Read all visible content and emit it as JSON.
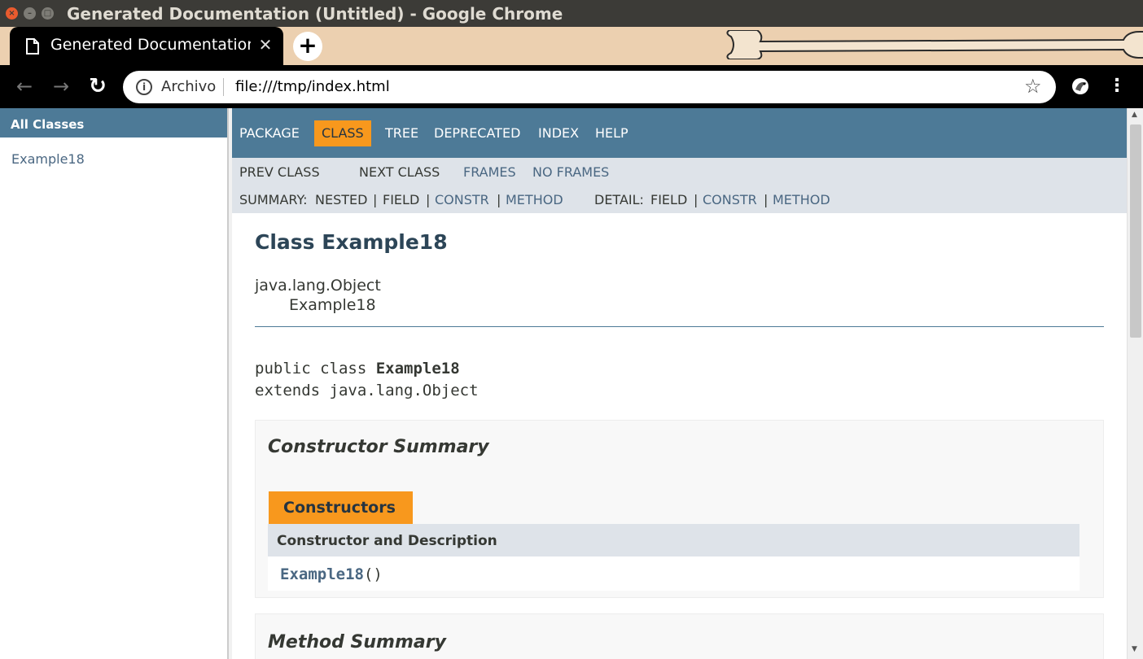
{
  "window": {
    "title": "Generated Documentation (Untitled) - Google Chrome"
  },
  "tab": {
    "title": "Generated Documentation (Untitled)",
    "close_glyph": "✕",
    "new_tab_glyph": "+"
  },
  "toolbar": {
    "back_glyph": "←",
    "forward_glyph": "→",
    "reload_glyph": "↻",
    "origin_chip": "Archivo",
    "url": "file:///tmp/index.html",
    "star_glyph": "☆",
    "menu_glyph": "⋮"
  },
  "left_frame": {
    "header": "All Classes",
    "classes": [
      "Example18"
    ]
  },
  "top_nav": {
    "items": [
      "PACKAGE",
      "CLASS",
      "TREE",
      "DEPRECATED",
      "INDEX",
      "HELP"
    ],
    "active": "CLASS"
  },
  "sub_nav": {
    "prev_class": "PREV CLASS",
    "next_class": "NEXT CLASS",
    "frames": "FRAMES",
    "no_frames": "NO FRAMES",
    "summary_label": "SUMMARY:",
    "summary_nested": "NESTED",
    "summary_field": "FIELD",
    "summary_constr": "CONSTR",
    "summary_method": "METHOD",
    "detail_label": "DETAIL:",
    "detail_field": "FIELD",
    "detail_constr": "CONSTR",
    "detail_method": "METHOD",
    "separator": "|"
  },
  "class_page": {
    "title": "Class Example18",
    "inheritance": [
      "java.lang.Object",
      "Example18"
    ],
    "declaration_prefix": "public class ",
    "declaration_name": "Example18",
    "declaration_extends": "extends java.lang.Object",
    "constructor_summary": {
      "heading": "Constructor Summary",
      "caption": "Constructors",
      "column_header": "Constructor and Description",
      "rows": [
        {
          "name": "Example18",
          "params": "()"
        }
      ]
    },
    "method_summary": {
      "heading": "Method Summary"
    }
  },
  "colors": {
    "nav_blue": "#4d7a97",
    "active_orange": "#f8981d",
    "subnav_gray": "#dee3e9",
    "link_blue": "#4a6782"
  }
}
